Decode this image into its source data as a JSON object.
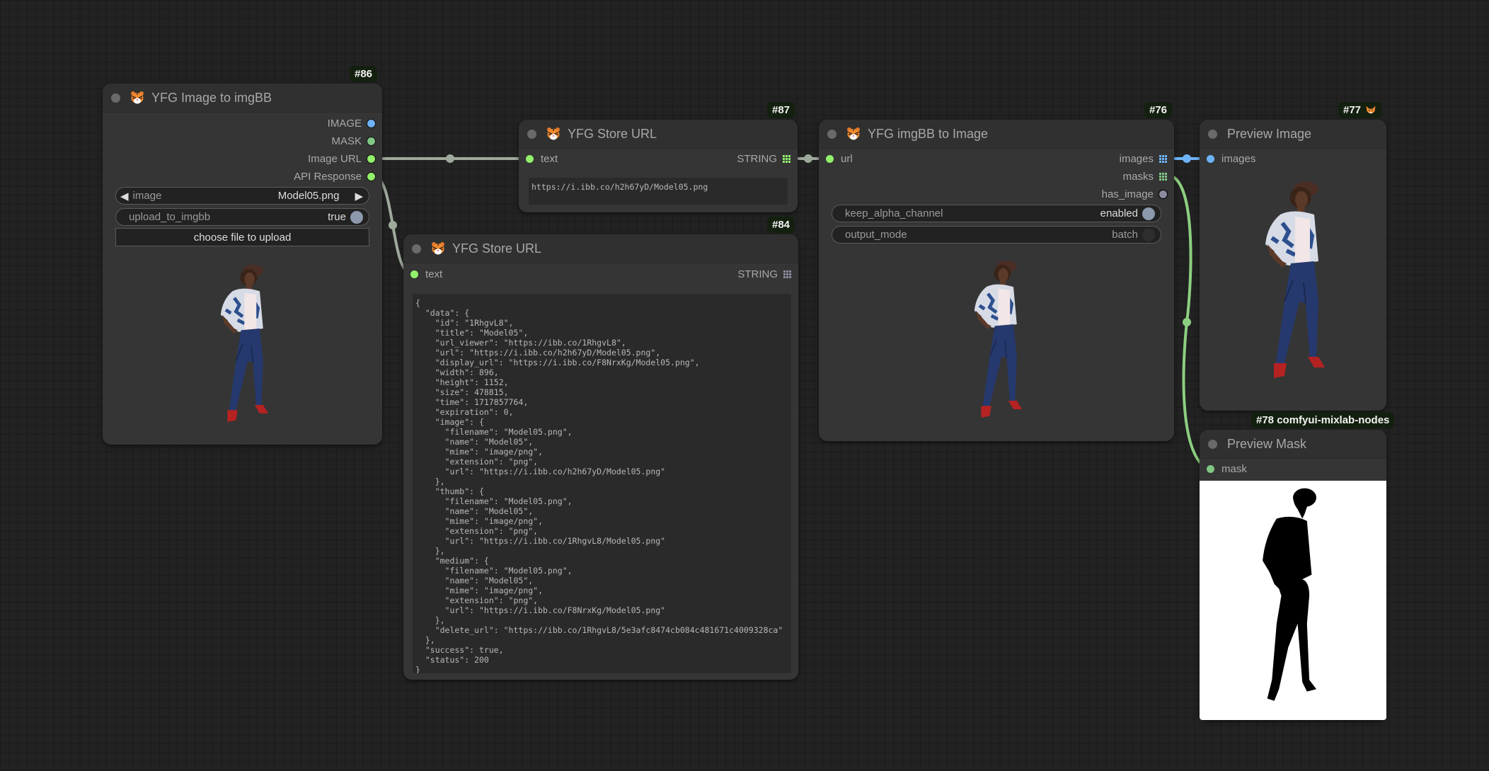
{
  "colors": {
    "image_slot": "#6eb3f7",
    "mask_slot": "#81c784",
    "string_slot": "#92f06a",
    "boolean_slot": "#8a8aa0",
    "wire_string": "#9da99a",
    "wire_image": "#6eb3f7",
    "wire_mask": "#8ccf80",
    "toggle_on": "#8d9aad",
    "toggle_off": "#2e2e2e"
  },
  "nodes": {
    "n86": {
      "id": "#86",
      "title": "YFG Image to imgBB",
      "icon": "tiger-icon",
      "outputs": [
        "IMAGE",
        "MASK",
        "Image URL",
        "API Response"
      ],
      "widgets": {
        "image_label": "image",
        "image_value": "Model05.png",
        "upload_label": "upload_to_imgbb",
        "upload_value": "true",
        "choose_button": "choose file to upload"
      },
      "preview_alt": "Model05.png preview"
    },
    "n87": {
      "id": "#87",
      "title": "YFG Store URL",
      "icon": "tiger-icon",
      "input": "text",
      "output": "STRING",
      "text_value": "https://i.ibb.co/h2h67yD/Model05.png"
    },
    "n84": {
      "id": "#84",
      "title": "YFG Store URL",
      "icon": "tiger-icon",
      "input": "text",
      "output": "STRING",
      "text_value": "{\n  \"data\": {\n    \"id\": \"1RhgvL8\",\n    \"title\": \"Model05\",\n    \"url_viewer\": \"https://ibb.co/1RhgvL8\",\n    \"url\": \"https://i.ibb.co/h2h67yD/Model05.png\",\n    \"display_url\": \"https://i.ibb.co/F8NrxKg/Model05.png\",\n    \"width\": 896,\n    \"height\": 1152,\n    \"size\": 478815,\n    \"time\": 1717857764,\n    \"expiration\": 0,\n    \"image\": {\n      \"filename\": \"Model05.png\",\n      \"name\": \"Model05\",\n      \"mime\": \"image/png\",\n      \"extension\": \"png\",\n      \"url\": \"https://i.ibb.co/h2h67yD/Model05.png\"\n    },\n    \"thumb\": {\n      \"filename\": \"Model05.png\",\n      \"name\": \"Model05\",\n      \"mime\": \"image/png\",\n      \"extension\": \"png\",\n      \"url\": \"https://i.ibb.co/1RhgvL8/Model05.png\"\n    },\n    \"medium\": {\n      \"filename\": \"Model05.png\",\n      \"name\": \"Model05\",\n      \"mime\": \"image/png\",\n      \"extension\": \"png\",\n      \"url\": \"https://i.ibb.co/F8NrxKg/Model05.png\"\n    },\n    \"delete_url\": \"https://ibb.co/1RhgvL8/5e3afc8474cb084c481671c4009328ca\"\n  },\n  \"success\": true,\n  \"status\": 200\n}"
    },
    "n76": {
      "id": "#76",
      "title": "YFG imgBB to Image",
      "icon": "tiger-icon",
      "input": "url",
      "outputs": [
        "images",
        "masks",
        "has_image"
      ],
      "widgets": {
        "alpha_label": "keep_alpha_channel",
        "alpha_value": "enabled",
        "mode_label": "output_mode",
        "mode_value": "batch"
      }
    },
    "n77": {
      "id": "#77",
      "badge_icon": "fox-icon",
      "title": "Preview Image",
      "input": "images"
    },
    "n78": {
      "id": "#78 comfyui-mixlab-nodes",
      "title": "Preview Mask",
      "input": "mask"
    }
  }
}
